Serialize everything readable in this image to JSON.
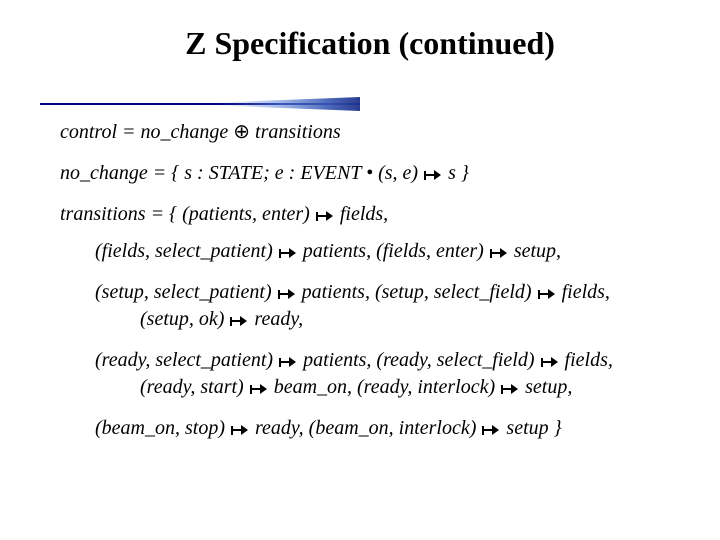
{
  "title": "Z Specification (continued)",
  "lines": {
    "control": "control = no_change ⊕ transitions",
    "no_change_pre": "no_change = { s : STATE;  e : EVENT • (s, e)  ",
    "no_change_post": " s }",
    "trans_header_pre": "transitions = { (patients, enter) ",
    "trans_header_post": "  fields,",
    "l1a_pre": "(fields, select_patient) ",
    "l1a_post": " patients, (fields, enter) ",
    "l1a_end": " setup,",
    "l2a_pre": "(setup, select_patient) ",
    "l2a_post": " patients, (setup, select_field) ",
    "l2a_end": "  fields,",
    "l2b_pre": "(setup, ok) ",
    "l2b_post": "  ready,",
    "l3a_pre": "(ready, select_patient) ",
    "l3a_post": " patients,  (ready, select_field) ",
    "l3a_end": " fields,",
    "l3b_pre": "(ready, start) ",
    "l3b_post": "  beam_on,  (ready, interlock) ",
    "l3b_end": " setup,",
    "l4a_pre": "(beam_on, stop) ",
    "l4a_post": "  ready,  (beam_on, interlock) ",
    "l4a_end": " setup }"
  }
}
